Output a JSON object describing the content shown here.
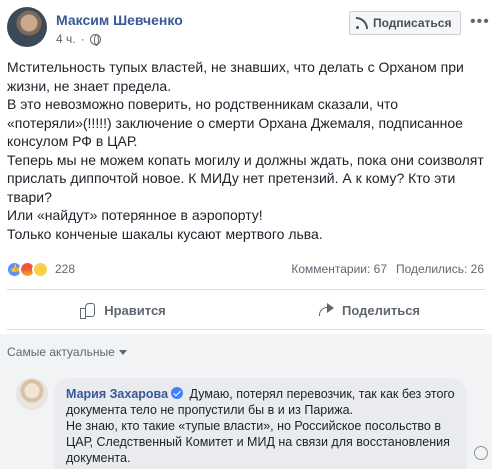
{
  "post": {
    "author": "Максим Шевченко",
    "time": "4 ч.",
    "privacy_icon": "globe-icon",
    "subscribe_label": "Подписаться",
    "more_label": "•••",
    "body": [
      "Мстительность тупых властей, не знавших, что делать с Орханом при жизни, не знает предела.",
      "В это невозможно поверить, но родственникам сказали, что «потеряли»(!!!!!) заключение о смерти Орхана Джемаля, подписанное консулом РФ в ЦАР.",
      "Теперь мы не можем копать могилу и должны ждать, пока они соизволят прислать диппочтой новое. К МИДу нет претензий. А к кому? Кто эти твари?",
      "Или «найдут» потерянное в аэропорту!",
      "Только конченые шакалы кусают мертвого льва."
    ]
  },
  "reactions": {
    "count": "228",
    "types": [
      "like",
      "angry",
      "sad"
    ],
    "comments": "Комментарии: 67",
    "shares": "Поделились: 26"
  },
  "actions": {
    "like": "Нравится",
    "share": "Поделиться"
  },
  "comments": {
    "sort_label": "Самые актуальные",
    "items": [
      {
        "author": "Мария Захарова",
        "verified": true,
        "text_1": "Думаю, потерял перевозчик, так как без этого документа тело не пропустили бы в и из Парижа.",
        "text_2": "Не знаю, кто такие «тупые власти», но Российское посольство в ЦАР, Следственный Комитет и МИД на связи для восстановления документа."
      }
    ]
  },
  "colors": {
    "link": "#385898",
    "text": "#1d2129",
    "muted": "#616770",
    "like_blue": "#5890ff"
  }
}
